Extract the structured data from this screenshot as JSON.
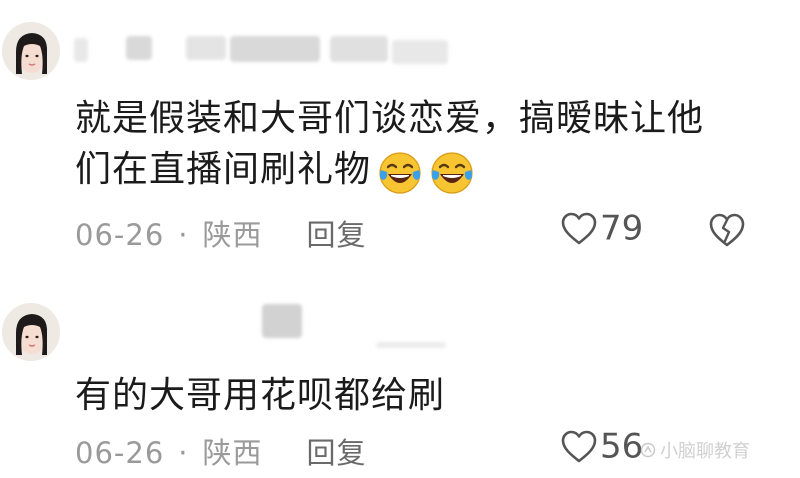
{
  "comments": [
    {
      "text_line_1": "就是假装和大哥们谈恋爱，搞暧昧让他",
      "text_line_2": "们在直播间刷礼物",
      "emojis": [
        "laughing-crying-emoji",
        "laughing-crying-emoji"
      ],
      "date": "06-26",
      "separator": "·",
      "location": "陕西",
      "reply_label": "回复",
      "likes": "79",
      "icons": {
        "like": "heart-icon",
        "dislike": "broken-heart-icon"
      }
    },
    {
      "text_line_1": "有的大哥用花呗都给刷",
      "date": "06-26",
      "separator": "·",
      "location": "陕西",
      "reply_label": "回复",
      "likes": "56",
      "icons": {
        "like": "heart-icon"
      }
    }
  ],
  "watermark": {
    "text": "小脑聊教育",
    "icon": "watermark-logo-icon"
  },
  "colors": {
    "background": "#ffffff",
    "text": "#1b1b1b",
    "meta": "#9a9a9a",
    "icon": "#555555",
    "emoji_face": "#f7c531",
    "emoji_tears": "#3aa0e8"
  }
}
